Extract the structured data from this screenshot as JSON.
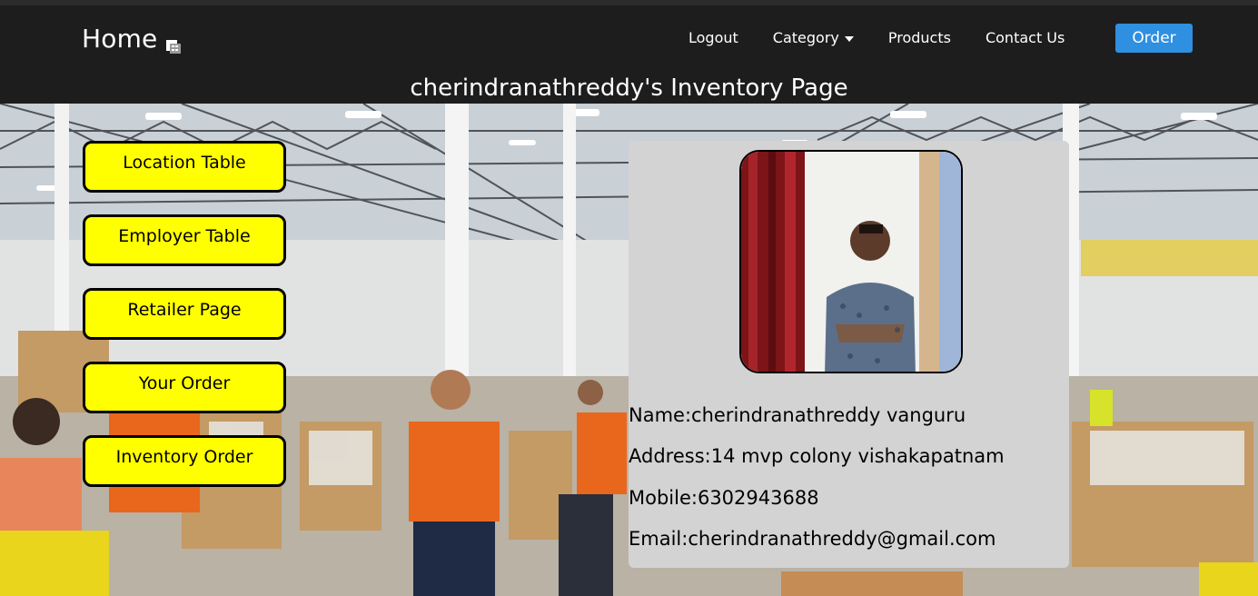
{
  "navbar": {
    "brand": "Home",
    "links": {
      "logout": "Logout",
      "category": "Category",
      "products": "Products",
      "contact": "Contact Us"
    },
    "order_button": "Order"
  },
  "page_title": "cherindranathreddy's Inventory Page",
  "sidebar": {
    "buttons": [
      {
        "label": "Location Table"
      },
      {
        "label": "Employer Table"
      },
      {
        "label": "Retailer Page"
      },
      {
        "label": "Your Order"
      },
      {
        "label": "Inventory Order"
      }
    ]
  },
  "profile": {
    "name_line": "Name:cherindranathreddy vanguru",
    "address_line": "Address:14 mvp colony vishakapatnam",
    "mobile_line": "Mobile:6302943688",
    "email_line": "Email:cherindranathreddy@gmail.com"
  },
  "colors": {
    "navbar_bg": "#1d1d1d",
    "order_button": "#2f8fe0",
    "sidebar_button": "#ffff00",
    "card_bg": "#d3d3d3"
  },
  "icons": {
    "brand_icon": "stacked-boxes-icon",
    "category_caret": "caret-down-icon"
  }
}
